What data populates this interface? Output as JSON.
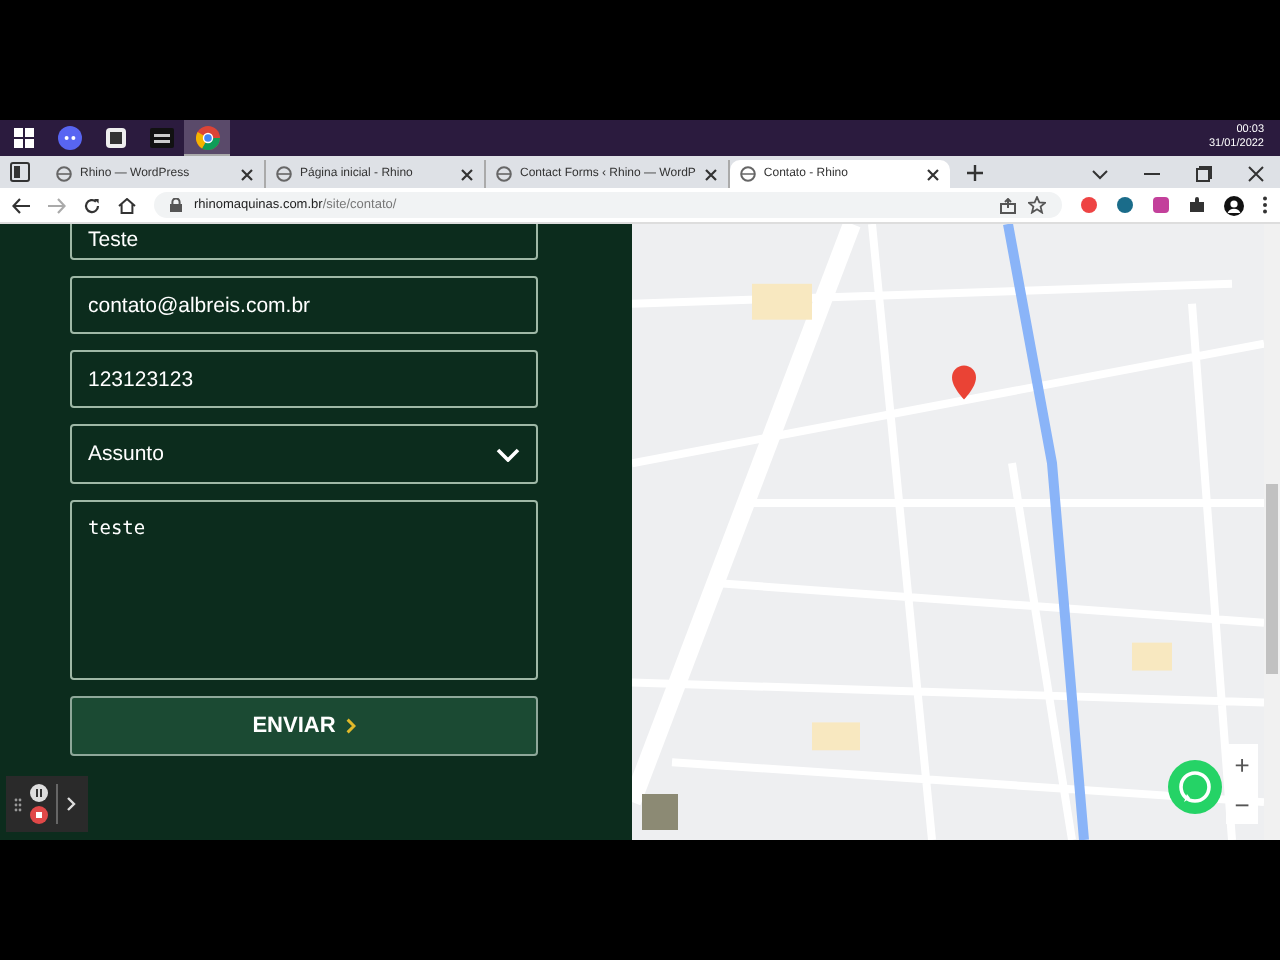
{
  "taskbar": {
    "apps": [
      {
        "kind": "windows",
        "selected": false
      },
      {
        "kind": "discord",
        "selected": false
      },
      {
        "kind": "tool",
        "selected": false
      },
      {
        "kind": "obs",
        "selected": false
      },
      {
        "kind": "chrome",
        "selected": true
      }
    ],
    "time": "00:03",
    "date": "31/01/2022"
  },
  "tabs": [
    {
      "title": "Rhino — WordPress",
      "selected": false
    },
    {
      "title": "Página inicial - Rhino",
      "selected": false
    },
    {
      "title": "Contact Forms ‹ Rhino — WordP",
      "selected": false
    },
    {
      "title": "Contato - Rhino",
      "selected": true
    }
  ],
  "address": {
    "domain": "rhinomaquinas.com.br",
    "path": "/site/contato/"
  },
  "form": {
    "fields": [
      {
        "kind": "text",
        "value": "Teste"
      },
      {
        "kind": "text",
        "value": "contato@albreis.com.br"
      },
      {
        "kind": "text",
        "value": "123123123"
      },
      {
        "kind": "select",
        "value": "Assunto"
      },
      {
        "kind": "textarea",
        "value": "teste"
      }
    ],
    "submit": "ENVIAR"
  },
  "map": {
    "zoom_in": "+",
    "zoom_out": "−"
  }
}
